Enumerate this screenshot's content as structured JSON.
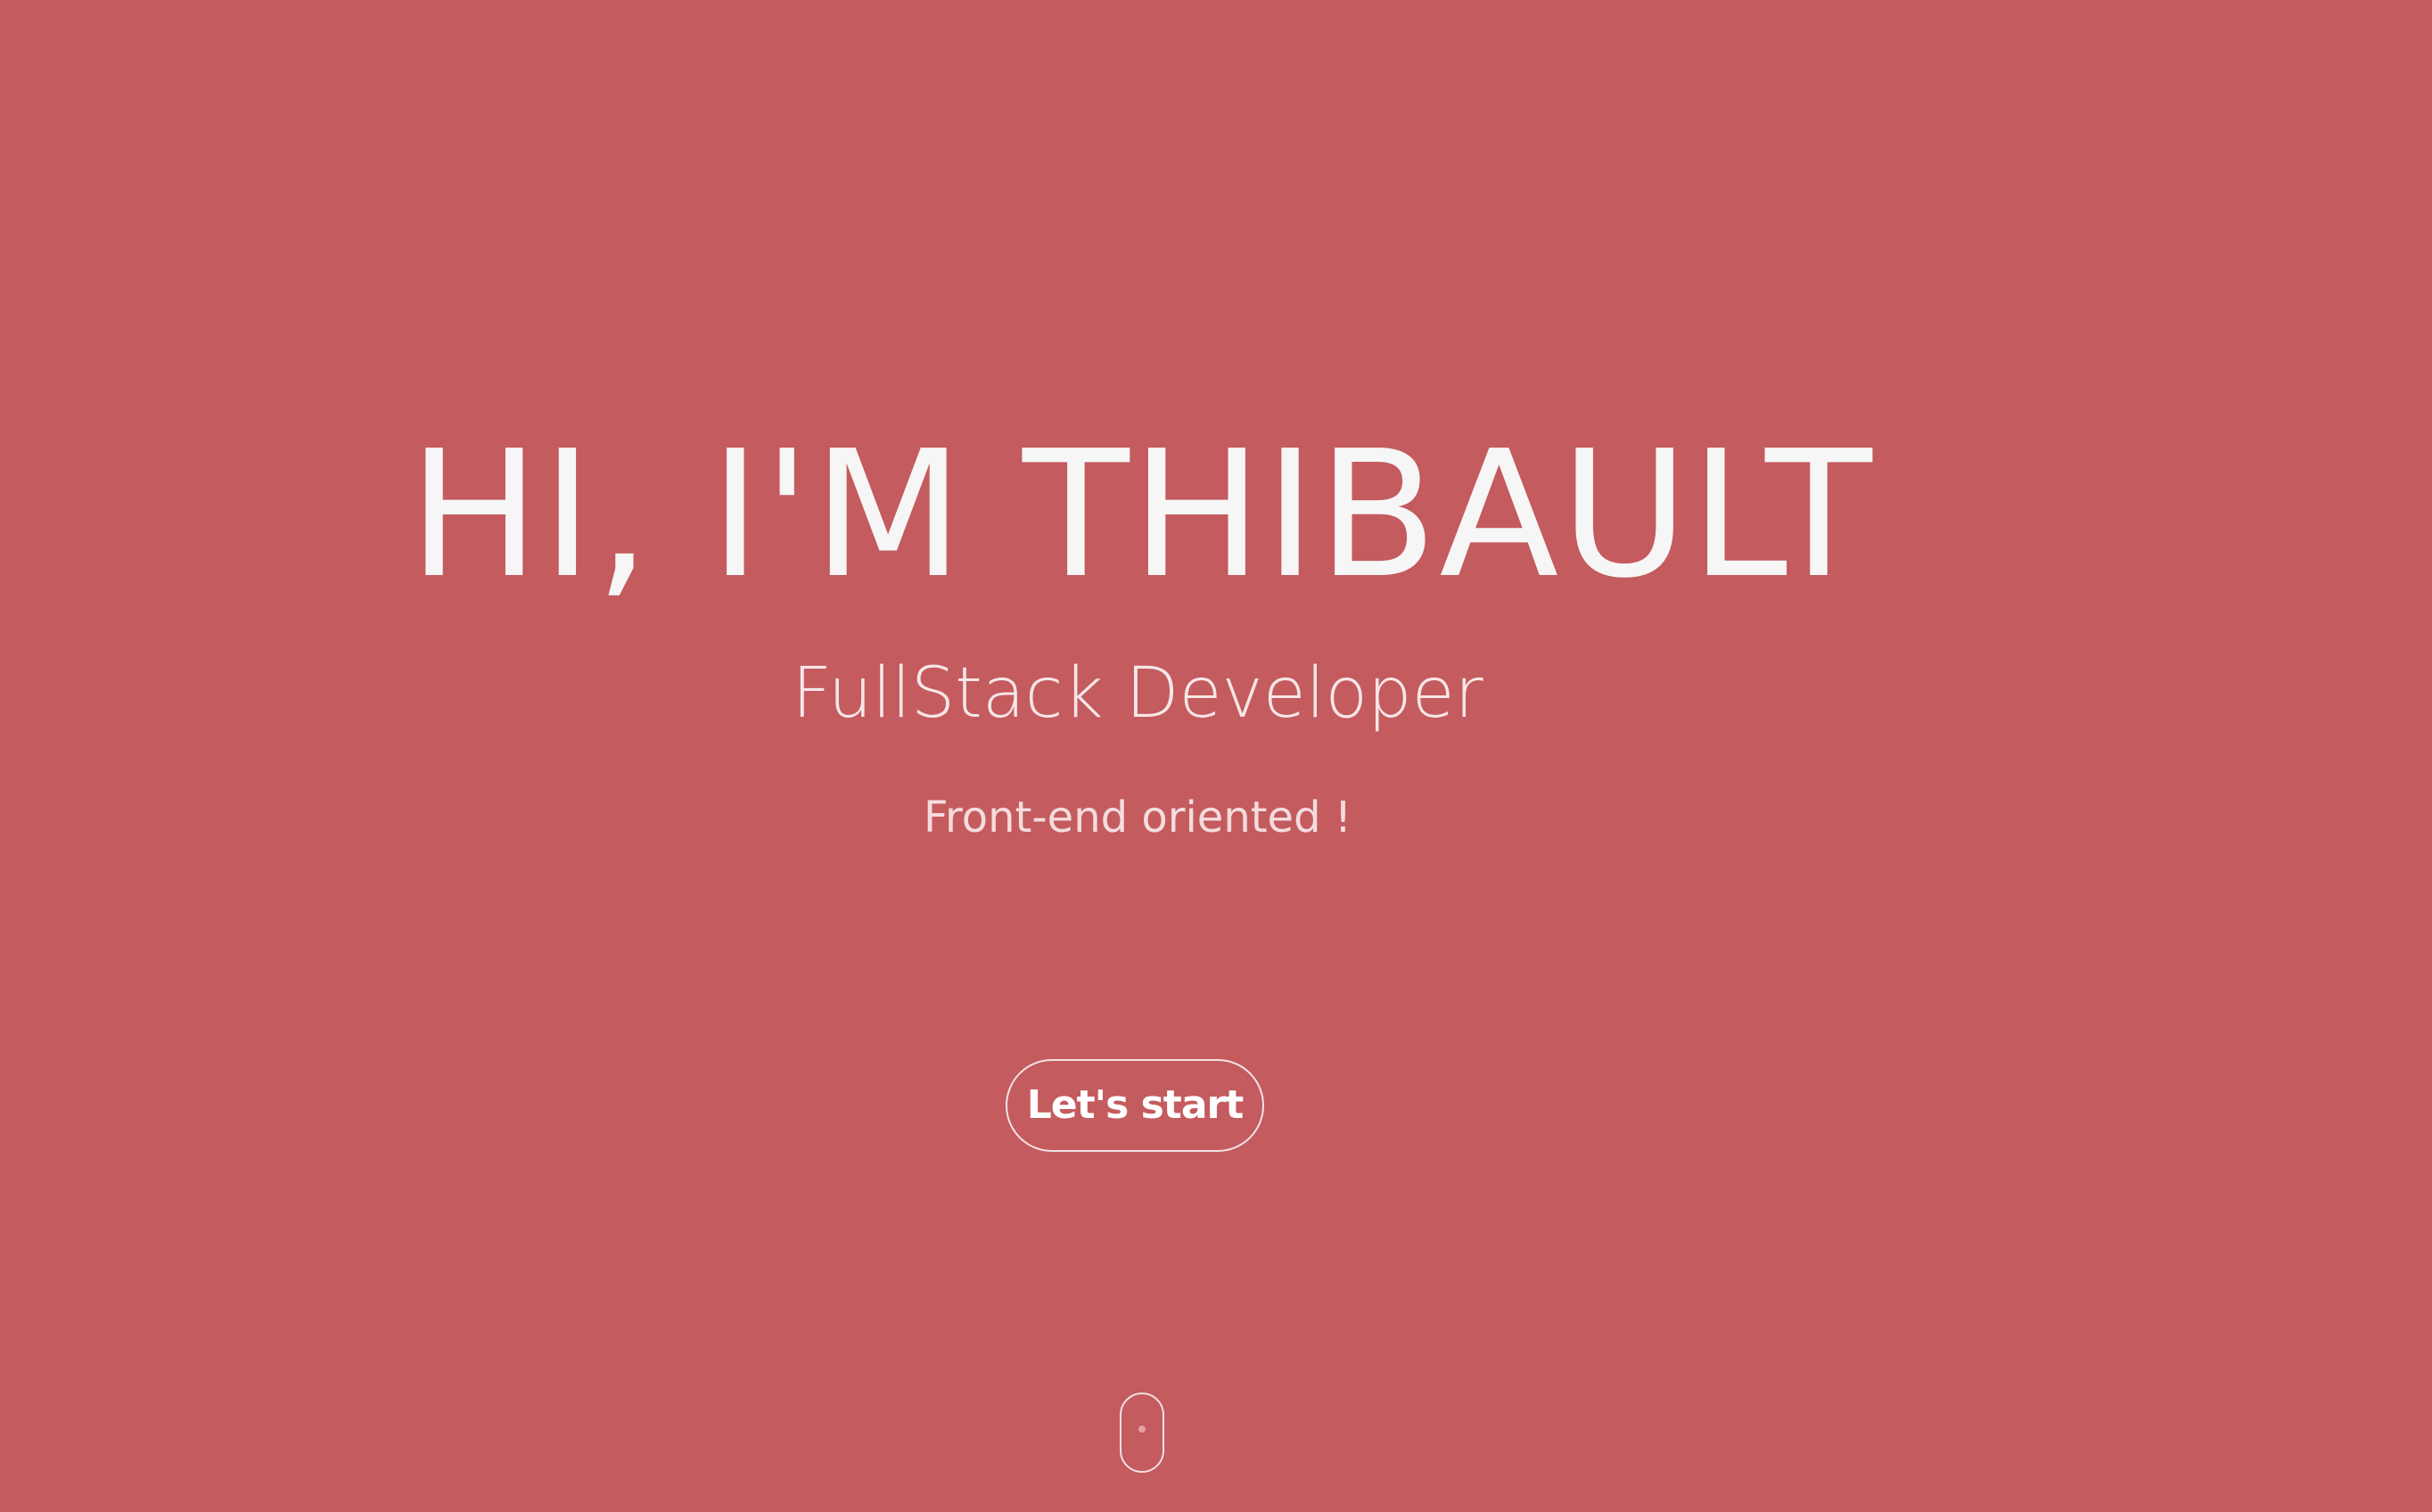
{
  "theme": {
    "background": "#c45b5f",
    "text": "#ffffff"
  },
  "hero": {
    "title": "HI, I'M THIBAULT",
    "subtitle": "FullStack Developer",
    "tagline": "Front-end oriented !",
    "cta_label": "Let's start",
    "scroll_icon": "mouse-scroll-icon"
  }
}
